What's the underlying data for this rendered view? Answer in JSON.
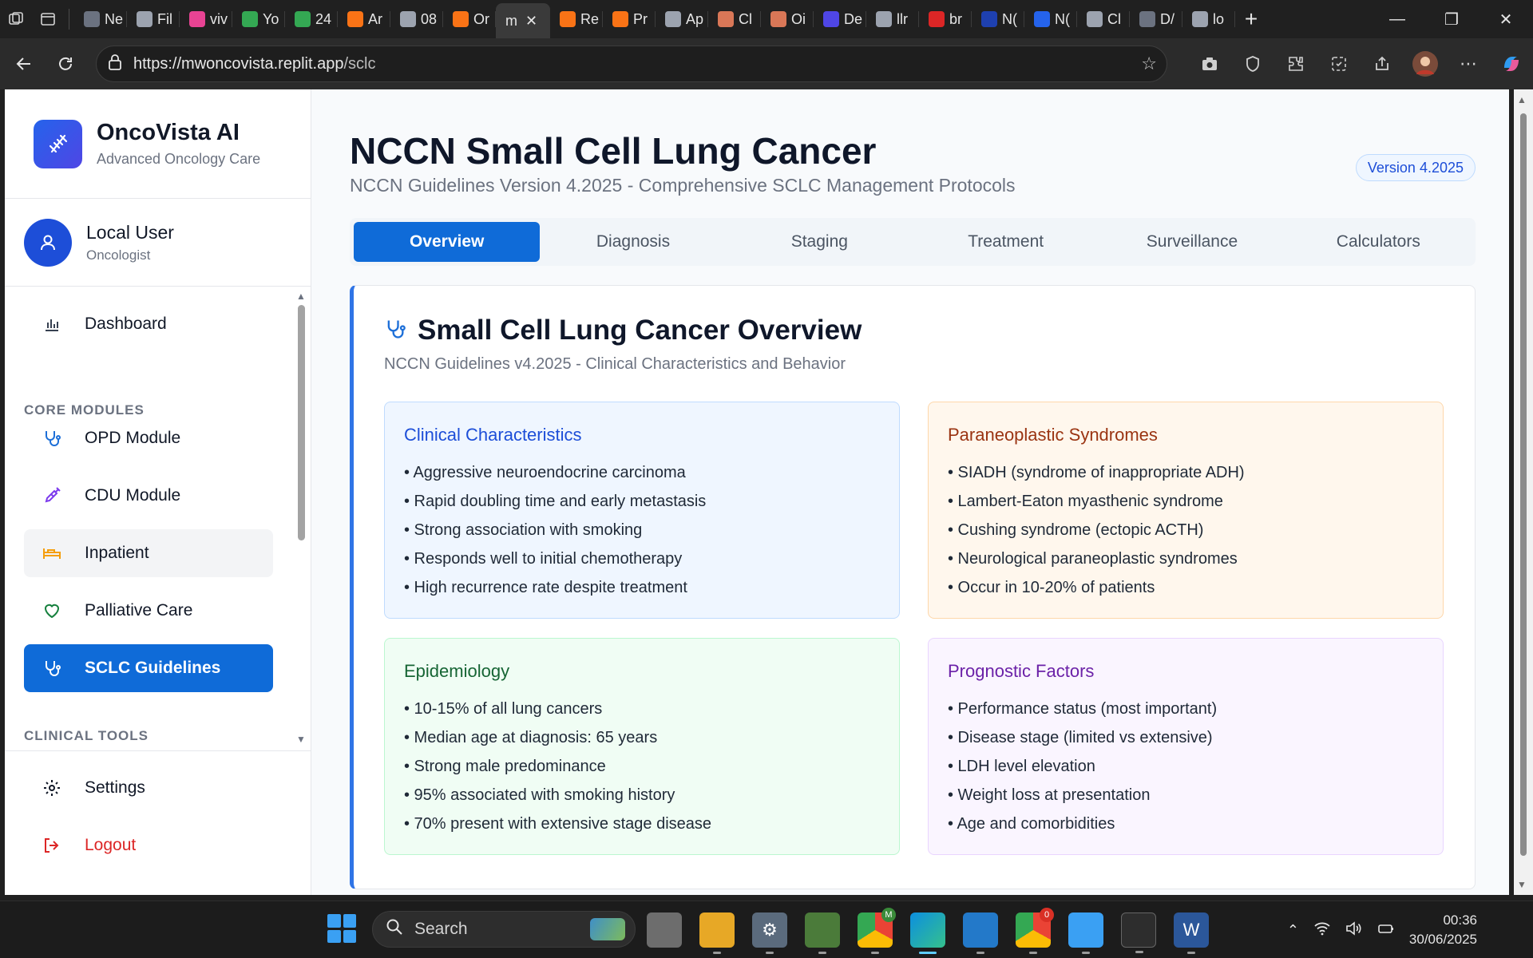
{
  "browser": {
    "tabs": [
      {
        "label": "Ne",
        "favicon_color": "#6b7280"
      },
      {
        "label": "Fil",
        "favicon_color": "#9ca3af"
      },
      {
        "label": "viv",
        "favicon_color": "#e84393"
      },
      {
        "label": "Yo",
        "favicon_color": "#34a853"
      },
      {
        "label": "24",
        "favicon_color": "#34a853"
      },
      {
        "label": "Ar",
        "favicon_color": "#f97316"
      },
      {
        "label": "08",
        "favicon_color": "#9ca3af"
      },
      {
        "label": "Or",
        "favicon_color": "#f97316"
      },
      {
        "label": "m",
        "favicon_color": "#3a3a3a",
        "active": true
      },
      {
        "label": "Re",
        "favicon_color": "#f97316"
      },
      {
        "label": "Pr",
        "favicon_color": "#f97316"
      },
      {
        "label": "Ap",
        "favicon_color": "#9ca3af"
      },
      {
        "label": "Cl",
        "favicon_color": "#d97757"
      },
      {
        "label": "Oi",
        "favicon_color": "#d97757"
      },
      {
        "label": "De",
        "favicon_color": "#4f46e5"
      },
      {
        "label": "llr",
        "favicon_color": "#9ca3af"
      },
      {
        "label": "br",
        "favicon_color": "#dc2626"
      },
      {
        "label": "N(",
        "favicon_color": "#1e40af"
      },
      {
        "label": "N(",
        "favicon_color": "#2563eb"
      },
      {
        "label": "Cl",
        "favicon_color": "#9ca3af"
      },
      {
        "label": "D/",
        "favicon_color": "#6b7280"
      },
      {
        "label": "lo",
        "favicon_color": "#9ca3af"
      }
    ],
    "new_tab_label": "+",
    "url_base": "https://mwoncovista.replit.app",
    "url_path": "/sclc"
  },
  "sidebar": {
    "brand_name": "OncoVista AI",
    "brand_sub": "Advanced Oncology Care",
    "user_name": "Local User",
    "user_role": "Oncologist",
    "dashboard_label": "Dashboard",
    "section_core": "CORE MODULES",
    "items": [
      {
        "label": "OPD Module",
        "icon": "stethoscope-icon"
      },
      {
        "label": "CDU Module",
        "icon": "syringe-icon"
      },
      {
        "label": "Inpatient",
        "icon": "bed-icon"
      },
      {
        "label": "Palliative Care",
        "icon": "heart-icon"
      },
      {
        "label": "SCLC Guidelines",
        "icon": "stethoscope-icon"
      }
    ],
    "section_tools": "CLINICAL TOOLS",
    "settings_label": "Settings",
    "logout_label": "Logout"
  },
  "main": {
    "title": "NCCN Small Cell Lung Cancer",
    "subtitle": "NCCN Guidelines Version 4.2025 - Comprehensive SCLC Management Protocols",
    "version_badge": "Version 4.2025",
    "tabs": [
      "Overview",
      "Diagnosis",
      "Staging",
      "Treatment",
      "Surveillance",
      "Calculators"
    ],
    "active_tab": "Overview",
    "card_title": "Small Cell Lung Cancer Overview",
    "card_sub": "NCCN Guidelines v4.2025 - Clinical Characteristics and Behavior",
    "boxes": [
      {
        "title": "Clinical Characteristics",
        "items": [
          "• Aggressive neuroendocrine carcinoma",
          "• Rapid doubling time and early metastasis",
          "• Strong association with smoking",
          "• Responds well to initial chemotherapy",
          "• High recurrence rate despite treatment"
        ]
      },
      {
        "title": "Paraneoplastic Syndromes",
        "items": [
          "• SIADH (syndrome of inappropriate ADH)",
          "• Lambert-Eaton myasthenic syndrome",
          "• Cushing syndrome (ectopic ACTH)",
          "• Neurological paraneoplastic syndromes",
          "• Occur in 10-20% of patients"
        ]
      },
      {
        "title": "Epidemiology",
        "items": [
          "• 10-15% of all lung cancers",
          "• Median age at diagnosis: 65 years",
          "• Strong male predominance",
          "• 95% associated with smoking history",
          "• 70% present with extensive stage disease"
        ]
      },
      {
        "title": "Prognostic Factors",
        "items": [
          "• Performance status (most important)",
          "• Disease stage (limited vs extensive)",
          "• LDH level elevation",
          "• Weight loss at presentation",
          "• Age and comorbidities"
        ]
      }
    ]
  },
  "taskbar": {
    "search_label": "Search",
    "chrome_badge_1": "M",
    "chrome_badge_2": "0",
    "time": "00:36",
    "date": "30/06/2025"
  },
  "colors": {
    "accent": "#0f6bd8",
    "card_border": "#2f74e6"
  }
}
